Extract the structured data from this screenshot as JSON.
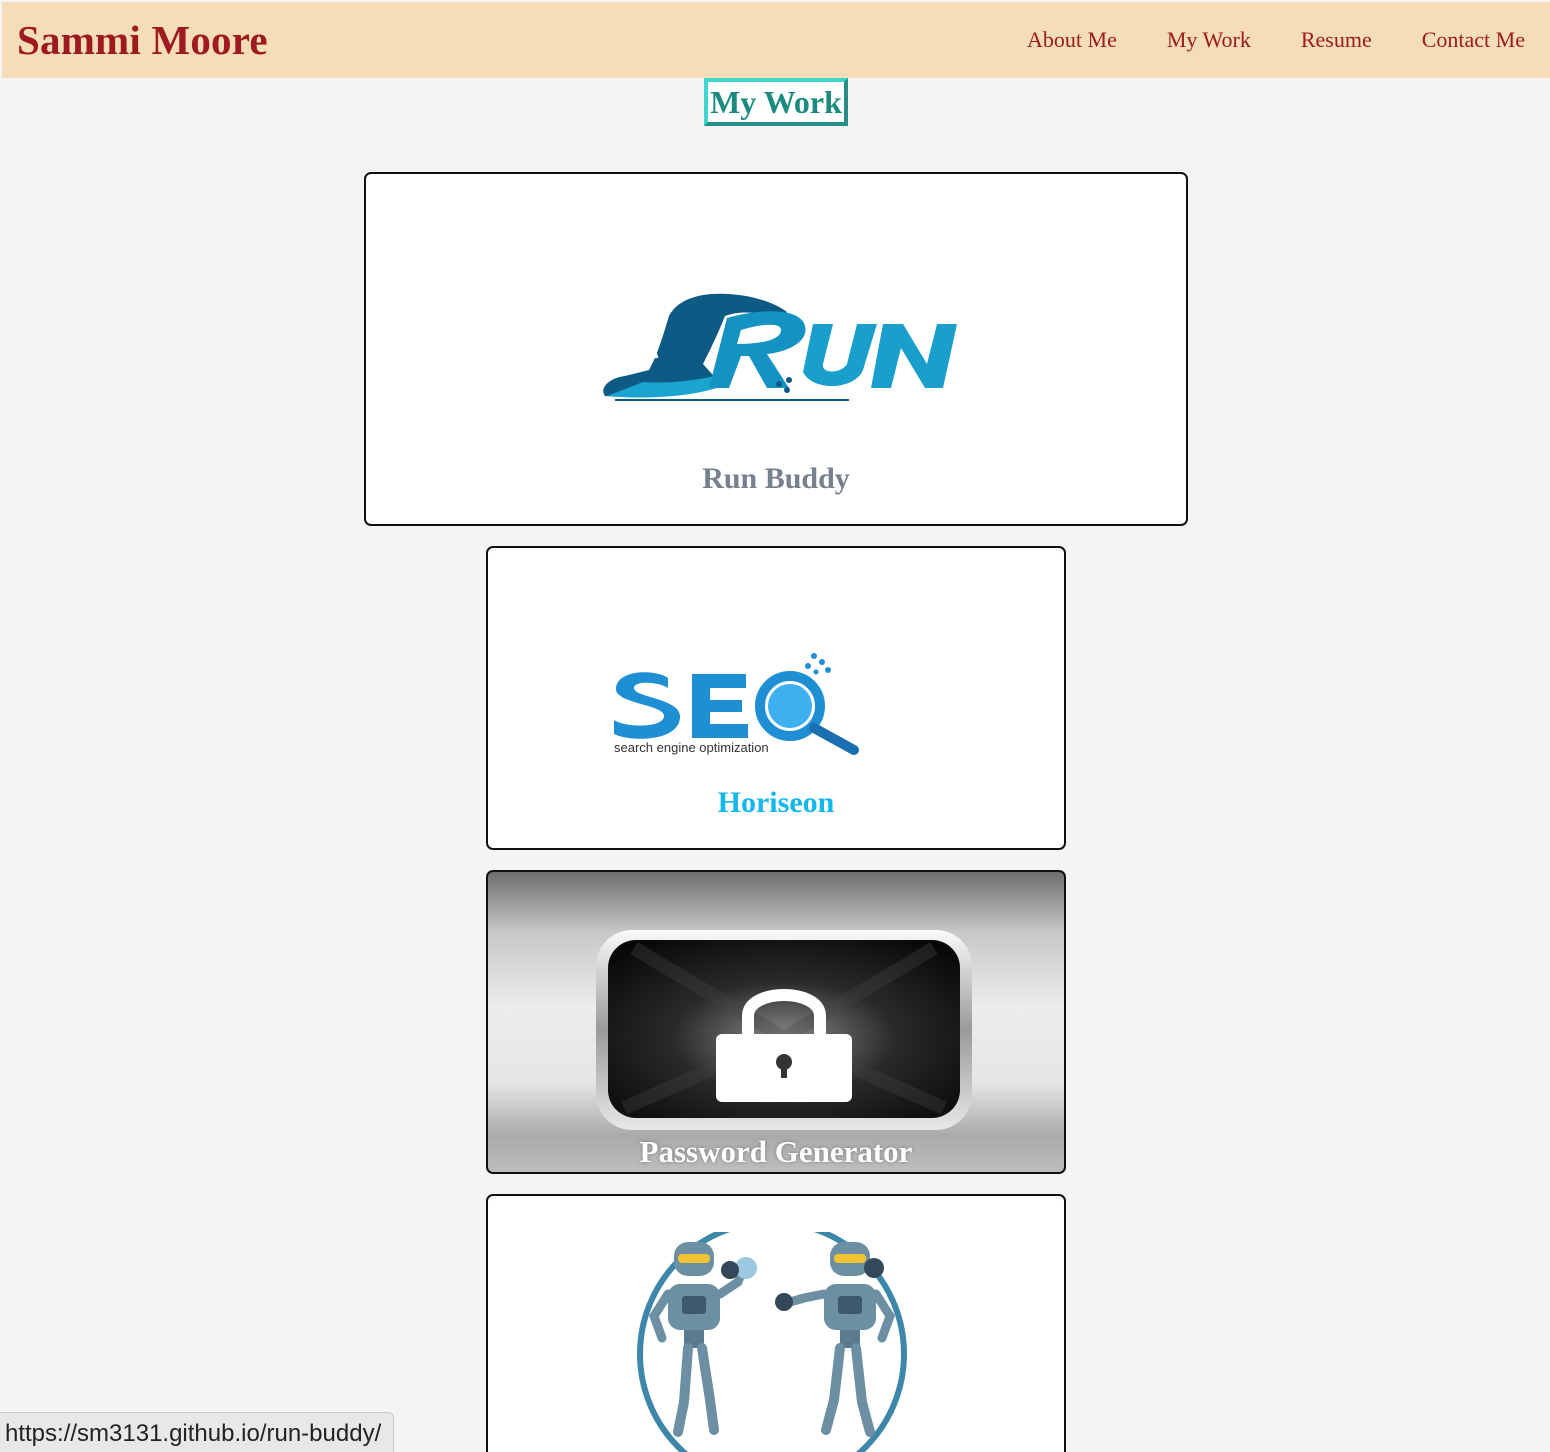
{
  "header": {
    "brand": "Sammi Moore",
    "nav": [
      {
        "label": "About Me"
      },
      {
        "label": "My Work"
      },
      {
        "label": "Resume"
      },
      {
        "label": "Contact Me"
      }
    ],
    "background_color": "#f5ddb7",
    "accent_color": "#9e1a20"
  },
  "section": {
    "title": "My Work",
    "title_color": "#1b8a80"
  },
  "projects": [
    {
      "title": "Run Buddy",
      "image": "run-logo",
      "title_color": "#76808f"
    },
    {
      "title": "Horiseon",
      "image": "seo-logo",
      "image_text": "search engine optimization",
      "title_color": "#12b7ec"
    },
    {
      "title": "Password Generator",
      "image": "lock-icon",
      "title_color": "#ffffff"
    },
    {
      "title": "",
      "image": "robots-illustration"
    }
  ],
  "status_bar": {
    "url": "https://sm3131.github.io/run-buddy/"
  }
}
